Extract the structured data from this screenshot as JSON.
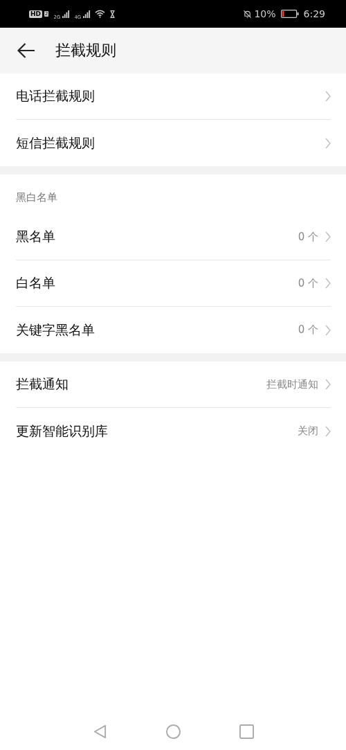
{
  "status_bar": {
    "hd": "HD",
    "sim": "2",
    "signals": [
      "2G",
      "4G"
    ],
    "battery": "10%",
    "time": "6:29"
  },
  "header": {
    "title": "拦截规则"
  },
  "sections": [
    {
      "items": [
        {
          "label": "电话拦截规则"
        },
        {
          "label": "短信拦截规则"
        }
      ]
    },
    {
      "heading": "黑白名单",
      "items": [
        {
          "label": "黑名单",
          "value": "0 个"
        },
        {
          "label": "白名单",
          "value": "0 个"
        },
        {
          "label": "关键字黑名单",
          "value": "0 个"
        }
      ]
    },
    {
      "items": [
        {
          "label": "拦截通知",
          "value": "拦截时通知"
        },
        {
          "label": "更新智能识别库",
          "value": "关闭"
        }
      ]
    }
  ]
}
